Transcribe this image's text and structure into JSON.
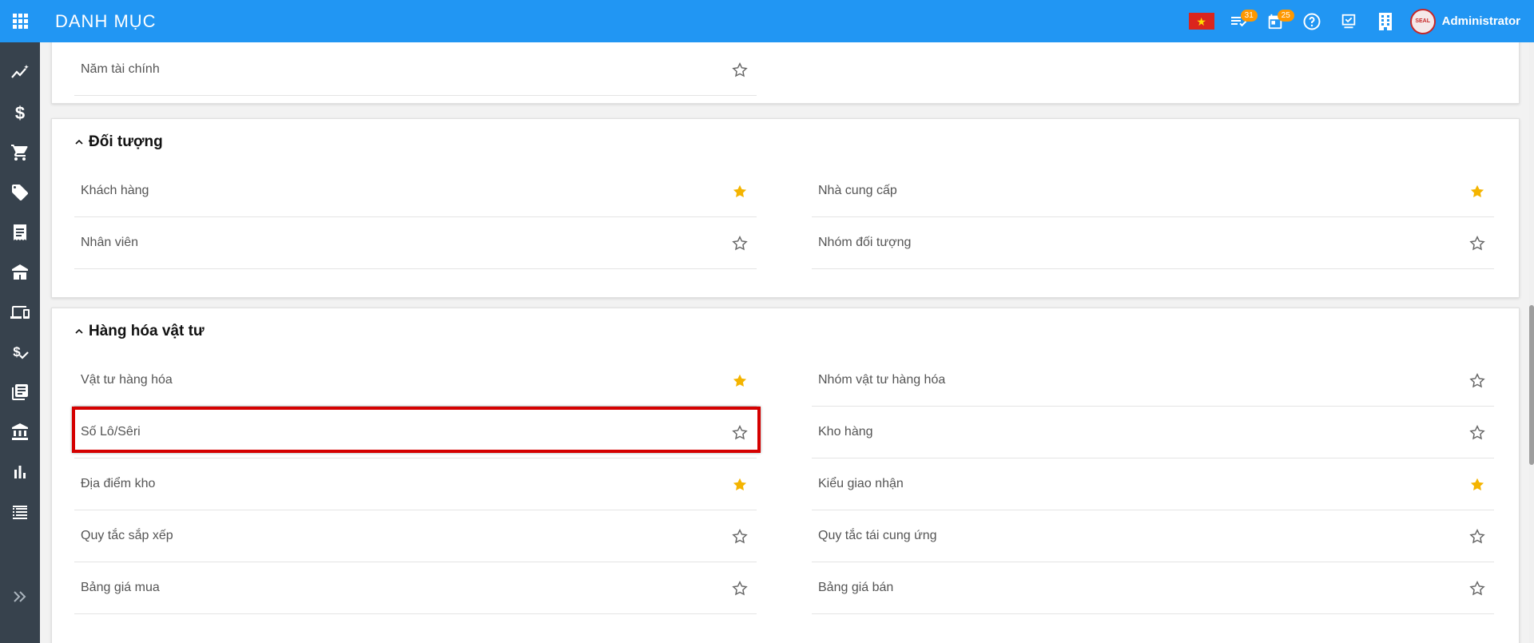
{
  "header": {
    "title": "DANH MỤC",
    "tasks_badge": "31",
    "calendar_badge": "25",
    "user_name": "Administrator",
    "avatar_text": "SEAL",
    "accent": "#2196f3",
    "badge_color": "#ff9800"
  },
  "sidebar": {
    "icons": [
      "analytics-icon",
      "dollar-icon",
      "cart-icon",
      "tag-icon",
      "receipt-icon",
      "inventory-icon",
      "devices-icon",
      "payment-check-icon",
      "book-icon",
      "bank-icon",
      "bar-chart-icon",
      "list-icon",
      "expand-icon"
    ]
  },
  "sections": {
    "top": {
      "items": [
        {
          "label": "Năm tài chính",
          "starred": false
        }
      ]
    },
    "doi_tuong": {
      "title": "Đối tượng",
      "items": [
        {
          "label": "Khách hàng",
          "starred": true
        },
        {
          "label": "Nhà cung cấp",
          "starred": true
        },
        {
          "label": "Nhân viên",
          "starred": false
        },
        {
          "label": "Nhóm đối tượng",
          "starred": false
        }
      ]
    },
    "hang_hoa": {
      "title": "Hàng hóa vật tư",
      "items": [
        {
          "label": "Vật tư hàng hóa",
          "starred": true
        },
        {
          "label": "Nhóm vật tư hàng hóa",
          "starred": false
        },
        {
          "label": "Số Lô/Sêri",
          "starred": false,
          "highlighted": true
        },
        {
          "label": "Kho hàng",
          "starred": false
        },
        {
          "label": "Địa điểm kho",
          "starred": true
        },
        {
          "label": "Kiểu giao nhận",
          "starred": true
        },
        {
          "label": "Quy tắc sắp xếp",
          "starred": false
        },
        {
          "label": "Quy tắc tái cung ứng",
          "starred": false
        },
        {
          "label": "Bảng giá mua",
          "starred": false
        },
        {
          "label": "Bảng giá bán",
          "starred": false
        }
      ]
    }
  },
  "colors": {
    "star_filled": "#f4b400",
    "star_empty": "#666666",
    "highlight": "#d50000",
    "sidebar": "#37424d"
  }
}
